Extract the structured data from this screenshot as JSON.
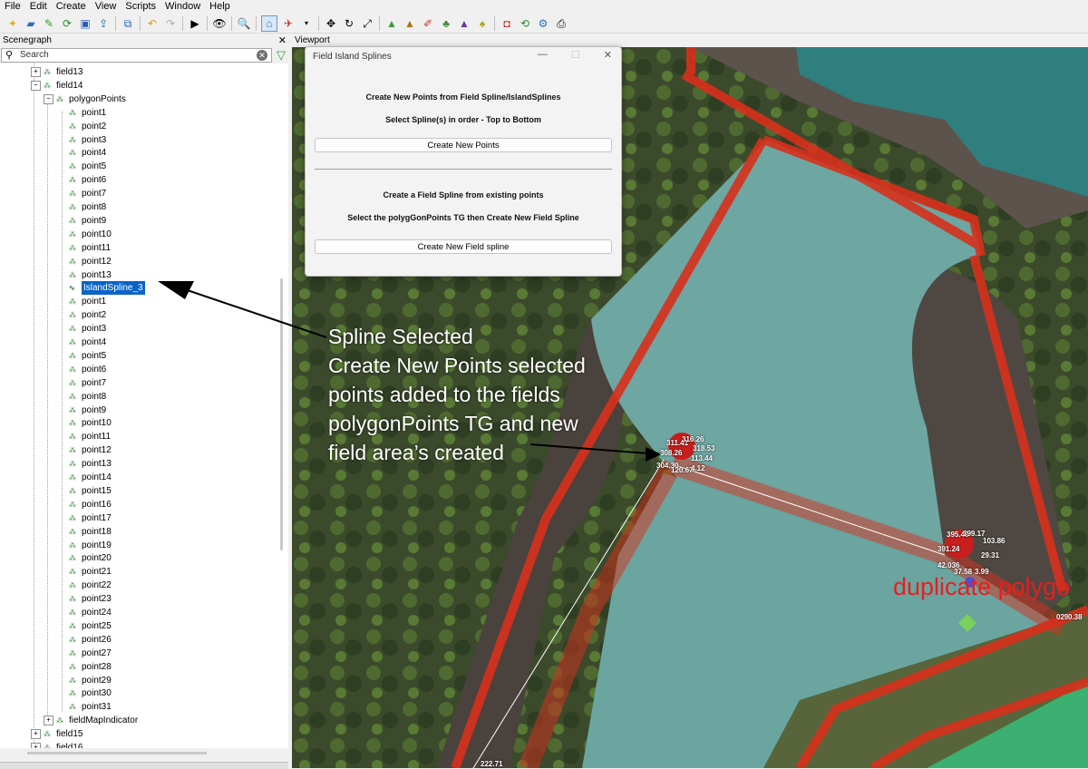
{
  "menu": [
    "File",
    "Edit",
    "Create",
    "View",
    "Scripts",
    "Window",
    "Help"
  ],
  "scenegraph": {
    "title": "Scenegraph",
    "close": "✕",
    "search_placeholder": "Search",
    "items": [
      {
        "label": "field13",
        "level": 1,
        "type": "tg",
        "expander": "+"
      },
      {
        "label": "field14",
        "level": 1,
        "type": "tg",
        "expander": "−"
      },
      {
        "label": "polygonPoints",
        "level": 2,
        "type": "tg",
        "expander": "−"
      },
      {
        "label": "point1",
        "level": 3,
        "type": "pt"
      },
      {
        "label": "point2",
        "level": 3,
        "type": "pt"
      },
      {
        "label": "point3",
        "level": 3,
        "type": "pt"
      },
      {
        "label": "point4",
        "level": 3,
        "type": "pt"
      },
      {
        "label": "point5",
        "level": 3,
        "type": "pt"
      },
      {
        "label": "point6",
        "level": 3,
        "type": "pt"
      },
      {
        "label": "point7",
        "level": 3,
        "type": "pt"
      },
      {
        "label": "point8",
        "level": 3,
        "type": "pt"
      },
      {
        "label": "point9",
        "level": 3,
        "type": "pt"
      },
      {
        "label": "point10",
        "level": 3,
        "type": "pt"
      },
      {
        "label": "point11",
        "level": 3,
        "type": "pt"
      },
      {
        "label": "point12",
        "level": 3,
        "type": "pt"
      },
      {
        "label": "point13",
        "level": 3,
        "type": "pt"
      },
      {
        "label": "IslandSpline_3",
        "level": 3,
        "type": "spline",
        "selected": true
      },
      {
        "label": "point1",
        "level": 3,
        "type": "pt"
      },
      {
        "label": "point2",
        "level": 3,
        "type": "pt"
      },
      {
        "label": "point3",
        "level": 3,
        "type": "pt"
      },
      {
        "label": "point4",
        "level": 3,
        "type": "pt"
      },
      {
        "label": "point5",
        "level": 3,
        "type": "pt"
      },
      {
        "label": "point6",
        "level": 3,
        "type": "pt"
      },
      {
        "label": "point7",
        "level": 3,
        "type": "pt"
      },
      {
        "label": "point8",
        "level": 3,
        "type": "pt"
      },
      {
        "label": "point9",
        "level": 3,
        "type": "pt"
      },
      {
        "label": "point10",
        "level": 3,
        "type": "pt"
      },
      {
        "label": "point11",
        "level": 3,
        "type": "pt"
      },
      {
        "label": "point12",
        "level": 3,
        "type": "pt"
      },
      {
        "label": "point13",
        "level": 3,
        "type": "pt"
      },
      {
        "label": "point14",
        "level": 3,
        "type": "pt"
      },
      {
        "label": "point15",
        "level": 3,
        "type": "pt"
      },
      {
        "label": "point16",
        "level": 3,
        "type": "pt"
      },
      {
        "label": "point17",
        "level": 3,
        "type": "pt"
      },
      {
        "label": "point18",
        "level": 3,
        "type": "pt"
      },
      {
        "label": "point19",
        "level": 3,
        "type": "pt"
      },
      {
        "label": "point20",
        "level": 3,
        "type": "pt"
      },
      {
        "label": "point21",
        "level": 3,
        "type": "pt"
      },
      {
        "label": "point22",
        "level": 3,
        "type": "pt"
      },
      {
        "label": "point23",
        "level": 3,
        "type": "pt"
      },
      {
        "label": "point24",
        "level": 3,
        "type": "pt"
      },
      {
        "label": "point25",
        "level": 3,
        "type": "pt"
      },
      {
        "label": "point26",
        "level": 3,
        "type": "pt"
      },
      {
        "label": "point27",
        "level": 3,
        "type": "pt"
      },
      {
        "label": "point28",
        "level": 3,
        "type": "pt"
      },
      {
        "label": "point29",
        "level": 3,
        "type": "pt"
      },
      {
        "label": "point30",
        "level": 3,
        "type": "pt"
      },
      {
        "label": "point31",
        "level": 3,
        "type": "pt"
      },
      {
        "label": "fieldMapIndicator",
        "level": 2,
        "type": "tg",
        "expander": "+"
      },
      {
        "label": "field15",
        "level": 1,
        "type": "tg",
        "expander": "+"
      },
      {
        "label": "field16",
        "level": 1,
        "type": "tg",
        "expander": "+"
      }
    ]
  },
  "viewport": {
    "title": "Viewport"
  },
  "dialog": {
    "title": "Field Island Splines",
    "minimize": "—",
    "maximize": "☐",
    "close": "✕",
    "text1": "Create New Points from Field Spline/IslandSplines",
    "text2": "Select Spline(s) in order - Top to Bottom",
    "button1": "Create New Points",
    "text3": "Create a Field Spline from existing points",
    "text4": "Select the polygGonPoints TG then Create New Field Spline",
    "button2": "Create New Field spline"
  },
  "annotation": {
    "line1": "Spline Selected",
    "line2": "Create New Points selected",
    "line3": "points added to the fields",
    "line4": "polygonPoints TG and new",
    "line5": "field area’s created"
  },
  "overlay": {
    "duplicate": "duplicate polygo",
    "labels": [
      "311.41",
      "316.26",
      "318.53",
      "308.26",
      "113.44",
      "304.30",
      "120.67",
      "4.12",
      "395.40",
      "399.17",
      "103.86",
      "391.24",
      "29.31",
      "42.036",
      "37.58",
      "3.99",
      "029",
      "0.38",
      "222.71"
    ]
  }
}
